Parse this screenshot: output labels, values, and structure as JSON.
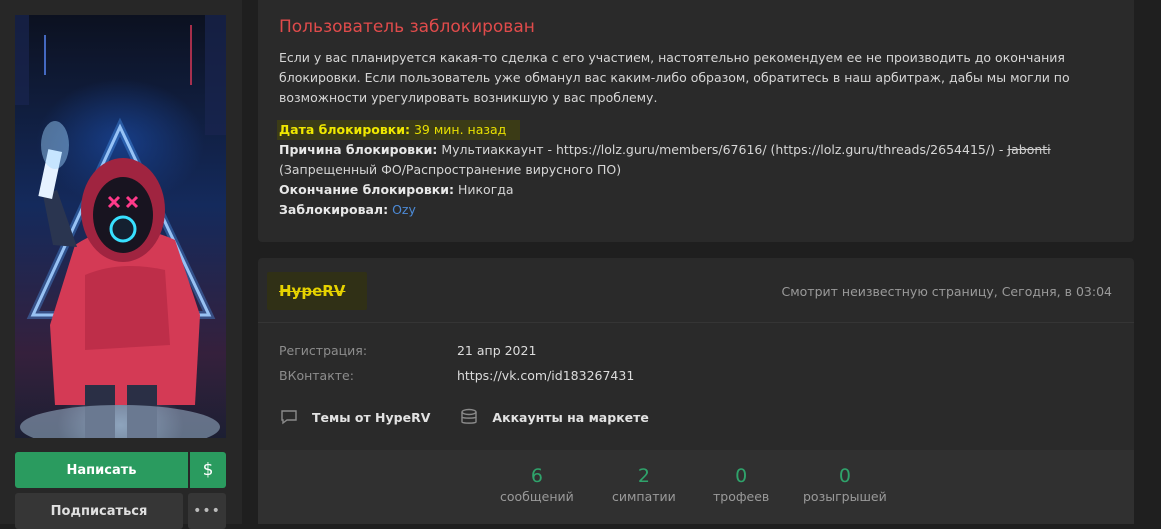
{
  "sidebar": {
    "write_button": "Написать",
    "money_icon": "$",
    "follow_button": "Подписаться",
    "more_icon": "•••"
  },
  "ban": {
    "title": "Пользователь заблокирован",
    "text": "Если у вас планируется какая-то сделка с его участием, настоятельно рекомендуем ее не производить до окончания блокировки. Если пользователь уже обманул вас каким-либо образом, обратитесь в наш арбитраж, дабы мы могли по возможности урегулировать возникшую у вас проблему.",
    "date_label": "Дата блокировки:",
    "date_value": "39 мин. назад",
    "reason_label": "Причина блокировки:",
    "reason_value": "Мультиаккаунт - https://lolz.guru/members/67616/ (https://lolz.guru/threads/2654415/) -",
    "reason_user": "Jabonti",
    "reason_extra": "(Запрещенный ФО/Распространение вирусного ПО)",
    "end_label": "Окончание блокировки:",
    "end_value": "Никогда",
    "by_label": "Заблокировал:",
    "by_value": "Ozy"
  },
  "profile": {
    "username": "HypeRV",
    "last_seen": "Смотрит неизвестную страницу, Сегодня, в 03:04",
    "info": [
      {
        "label": "Регистрация:",
        "value": "21 апр 2021"
      },
      {
        "label": "ВКонтакте:",
        "value": "https://vk.com/id183267431"
      }
    ],
    "threads_link": "Темы от HypeRV",
    "market_link": "Аккаунты на маркете",
    "stats": [
      {
        "value": "6",
        "label": "сообщений"
      },
      {
        "value": "2",
        "label": "симпатии"
      },
      {
        "value": "0",
        "label": "трофеев"
      },
      {
        "value": "0",
        "label": "розыгрышей"
      }
    ]
  },
  "colors": {
    "accent_green": "#2a9b5f",
    "ban_red": "#e04b4b",
    "highlight_yellow": "#e8e000",
    "stat_green": "#2fa36b"
  },
  "icons": [
    "dollar-icon",
    "more-dots-icon",
    "chat-bubble-icon",
    "database-icon"
  ]
}
